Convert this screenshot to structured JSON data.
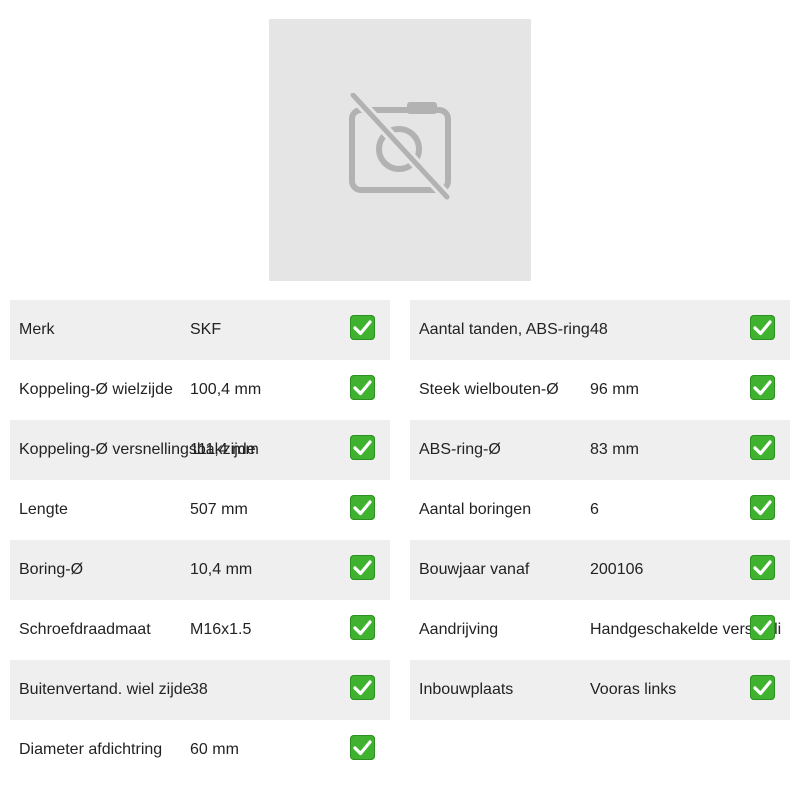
{
  "image": {
    "icon": "camera-off-icon"
  },
  "colors": {
    "placeholder_bg": "#e5e5e5",
    "row_shade": "#efefef",
    "check_green": "#3fb32f"
  },
  "left_table": [
    {
      "label": "Merk",
      "value": "SKF"
    },
    {
      "label": "Koppeling-Ø wielzijde",
      "value": "100,4 mm"
    },
    {
      "label": "Koppeling-Ø versnellingsbakzijde",
      "value": "111,4 mm"
    },
    {
      "label": "Lengte",
      "value": "507 mm"
    },
    {
      "label": "Boring-Ø",
      "value": "10,4 mm"
    },
    {
      "label": "Schroefdraadmaat",
      "value": "M16x1.5"
    },
    {
      "label": "Buitenvertand. wiel zijde",
      "value": "38"
    },
    {
      "label": "Diameter afdichtring",
      "value": "60 mm"
    }
  ],
  "right_table": [
    {
      "label": "Aantal tanden, ABS-ring",
      "value": "48"
    },
    {
      "label": "Steek wielbouten-Ø",
      "value": "96 mm"
    },
    {
      "label": "ABS-ring-Ø",
      "value": "83 mm"
    },
    {
      "label": "Aantal boringen",
      "value": "6"
    },
    {
      "label": "Bouwjaar vanaf",
      "value": "200106"
    },
    {
      "label": "Aandrijving",
      "value": "Handgeschakelde versnelli"
    },
    {
      "label": "Inbouwplaats",
      "value": "Vooras links"
    }
  ]
}
